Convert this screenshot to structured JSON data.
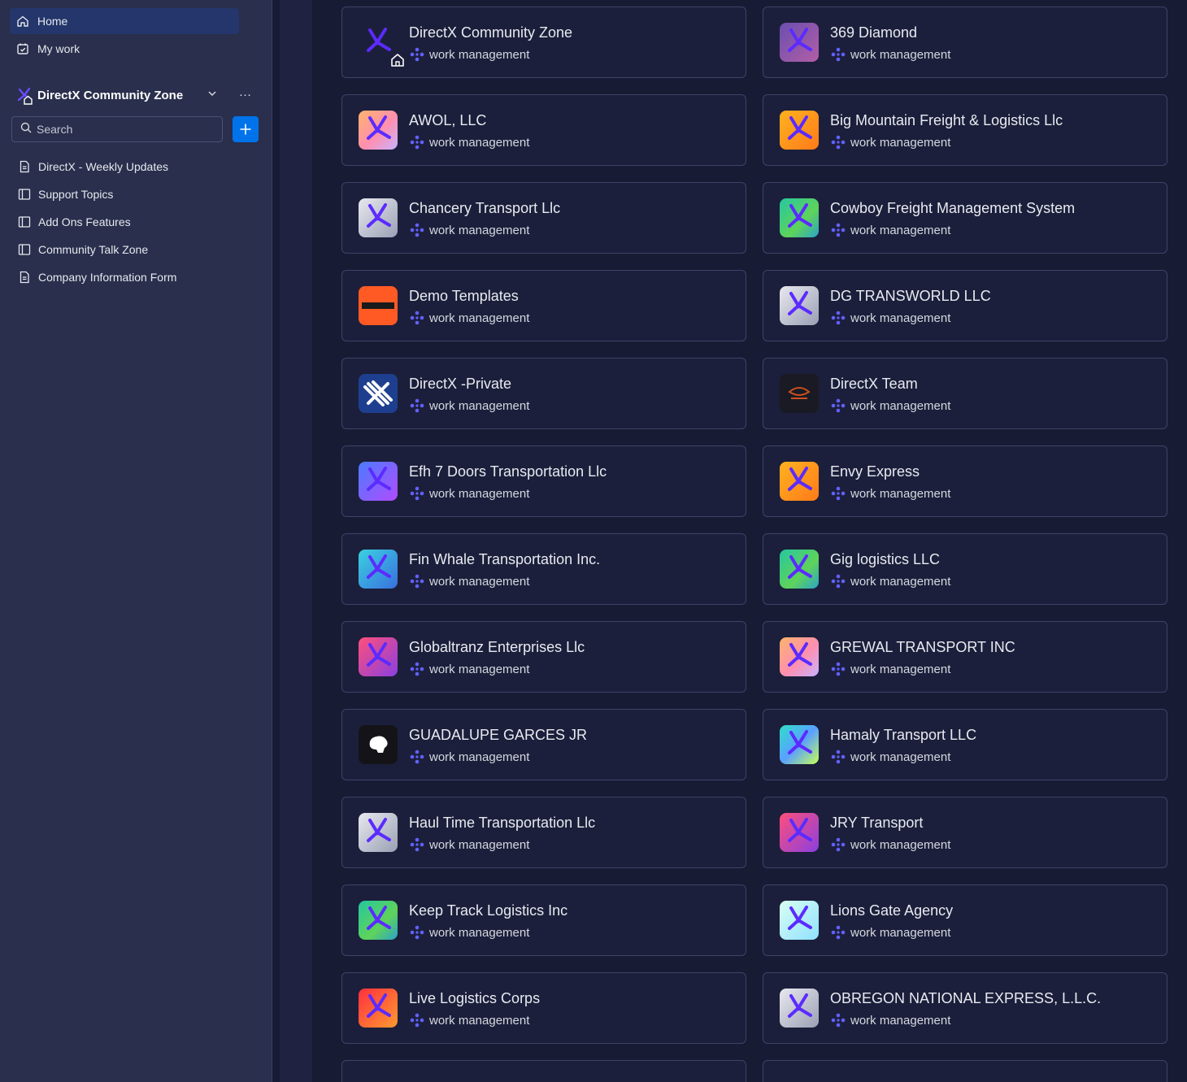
{
  "sidebar": {
    "nav": [
      {
        "label": "Home",
        "icon": "home-icon",
        "active": true
      },
      {
        "label": "My work",
        "icon": "calendar-check-icon",
        "active": false
      }
    ],
    "workspace": {
      "title": "DirectX Community Zone",
      "more": "…"
    },
    "search": {
      "placeholder": "Search"
    },
    "boards": [
      {
        "label": "DirectX - Weekly Updates",
        "icon": "doc-icon"
      },
      {
        "label": "Support Topics",
        "icon": "board-icon"
      },
      {
        "label": "Add Ons Features",
        "icon": "board-icon"
      },
      {
        "label": "Community Talk Zone",
        "icon": "board-icon"
      },
      {
        "label": "Company Information Form",
        "icon": "doc-icon"
      }
    ]
  },
  "workspaces": {
    "type_label": "work management",
    "cards": [
      {
        "name": "DirectX Community Zone",
        "logo_style": "plain",
        "home": true
      },
      {
        "name": "369 Diamond",
        "logo_style": "purple"
      },
      {
        "name": "AWOL, LLC",
        "logo_style": "warm"
      },
      {
        "name": "Big Mountain Freight & Logistics Llc",
        "logo_style": "orange"
      },
      {
        "name": "Chancery Transport Llc",
        "logo_style": "grey"
      },
      {
        "name": "Cowboy Freight Management System",
        "logo_style": "green"
      },
      {
        "name": "Demo Templates",
        "logo_style": "red"
      },
      {
        "name": "DG TRANSWORLD LLC",
        "logo_style": "grey"
      },
      {
        "name": "DirectX -Private",
        "logo_style": "blue"
      },
      {
        "name": "DirectX Team",
        "logo_style": "dark"
      },
      {
        "name": "Efh 7 Doors Transportation Llc",
        "logo_style": "violet"
      },
      {
        "name": "Envy Express",
        "logo_style": "orange"
      },
      {
        "name": "Fin Whale Transportation Inc.",
        "logo_style": "cyan"
      },
      {
        "name": "Gig logistics LLC",
        "logo_style": "green"
      },
      {
        "name": "Globaltranz Enterprises Llc",
        "logo_style": "pink"
      },
      {
        "name": "GREWAL TRANSPORT INC",
        "logo_style": "warm"
      },
      {
        "name": "GUADALUPE GARCES JR",
        "logo_style": "black"
      },
      {
        "name": "Hamaly Transport LLC",
        "logo_style": "rainbow"
      },
      {
        "name": "Haul Time Transportation Llc",
        "logo_style": "grey"
      },
      {
        "name": "JRY Transport",
        "logo_style": "pink"
      },
      {
        "name": "Keep Track Logistics Inc",
        "logo_style": "green"
      },
      {
        "name": "Lions Gate Agency",
        "logo_style": "mint"
      },
      {
        "name": "Live Logistics Corps",
        "logo_style": "redorange"
      },
      {
        "name": "OBREGON NATIONAL EXPRESS, L.L.C.",
        "logo_style": "grey"
      }
    ]
  },
  "colors": {
    "accent": "#0073ea",
    "active_nav": "#24366b",
    "sidebar_bg": "#292f4c",
    "page_bg": "#181b34",
    "work_mgmt_icon": "#6161ff"
  }
}
